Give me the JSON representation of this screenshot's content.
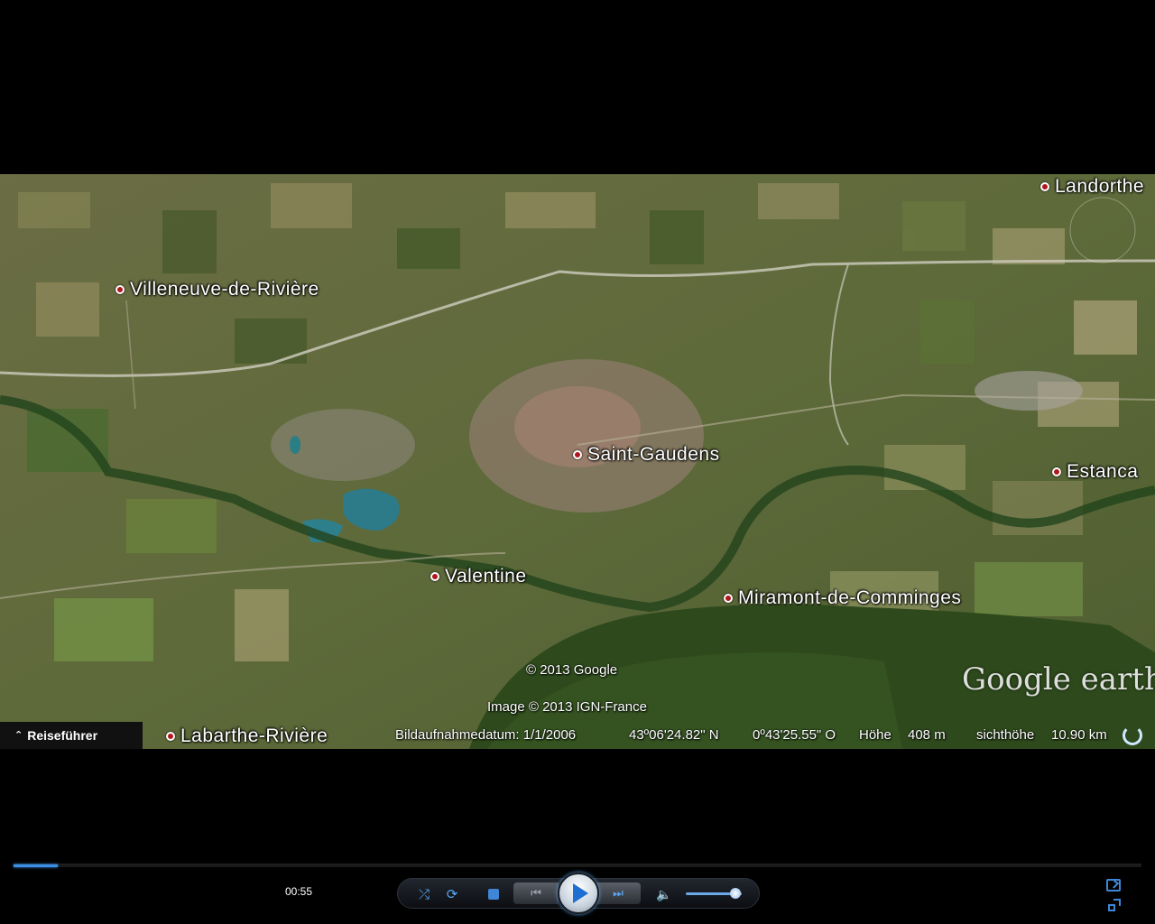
{
  "map": {
    "places": [
      {
        "id": "landorthe",
        "label": "Landorthe"
      },
      {
        "id": "villeneuve",
        "label": "Villeneuve-de-Rivière"
      },
      {
        "id": "saint-gaudens",
        "label": "Saint-Gaudens"
      },
      {
        "id": "estancarbon",
        "label": "Estanca"
      },
      {
        "id": "valentine",
        "label": "Valentine"
      },
      {
        "id": "miramont",
        "label": "Miramont-de-Comminges"
      },
      {
        "id": "labarthe",
        "label": "Labarthe-Rivière"
      }
    ],
    "copyright_google": "© 2013 Google",
    "copyright_ign": "Image © 2013 IGN-France",
    "logo_text": "Google earth"
  },
  "status": {
    "guide_label": "Reiseführer",
    "image_date": "Bildaufnahmedatum: 1/1/2006",
    "latitude": "43º06'24.82\" N",
    "longitude": "0º43'25.55\" O",
    "elevation_label": "Höhe",
    "elevation_value": "408 m",
    "eye_alt_label": "sichthöhe",
    "eye_alt_value": "10.90 km"
  },
  "player": {
    "time": "00:55",
    "progress_fraction": 0.039,
    "volume_fraction": 0.88,
    "colors": {
      "accent": "#3a8ee6",
      "marker": "#b0161b"
    },
    "icons": {
      "shuffle": "shuffle-icon",
      "repeat": "repeat-icon",
      "stop": "stop-icon",
      "previous": "previous-icon",
      "play": "play-icon",
      "next": "next-icon",
      "mute": "volume-icon"
    }
  }
}
